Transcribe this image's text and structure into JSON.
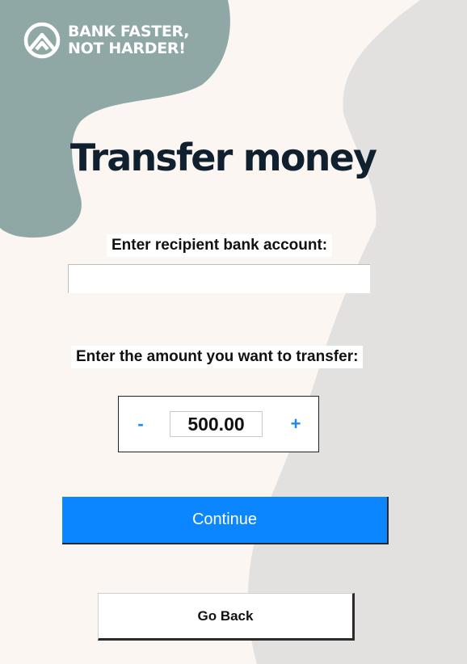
{
  "brand": {
    "line1": "BANK FASTER,",
    "line2": "NOT HARDER!",
    "icon": "mountain-logo-icon"
  },
  "page": {
    "title": "Transfer money"
  },
  "recipient": {
    "label": "Enter recipient bank account:",
    "value": "",
    "placeholder": ""
  },
  "amount": {
    "label": "Enter the amount you want to transfer:",
    "value": "500.00",
    "decrement_label": "-",
    "increment_label": "+"
  },
  "actions": {
    "continue_label": "Continue",
    "back_label": "Go Back"
  },
  "colors": {
    "background": "#fbf6f2",
    "teal_blob": "#8fa8a5",
    "grey_blob": "#e3e1df",
    "accent": "#0b86ff",
    "title": "#10202e"
  }
}
